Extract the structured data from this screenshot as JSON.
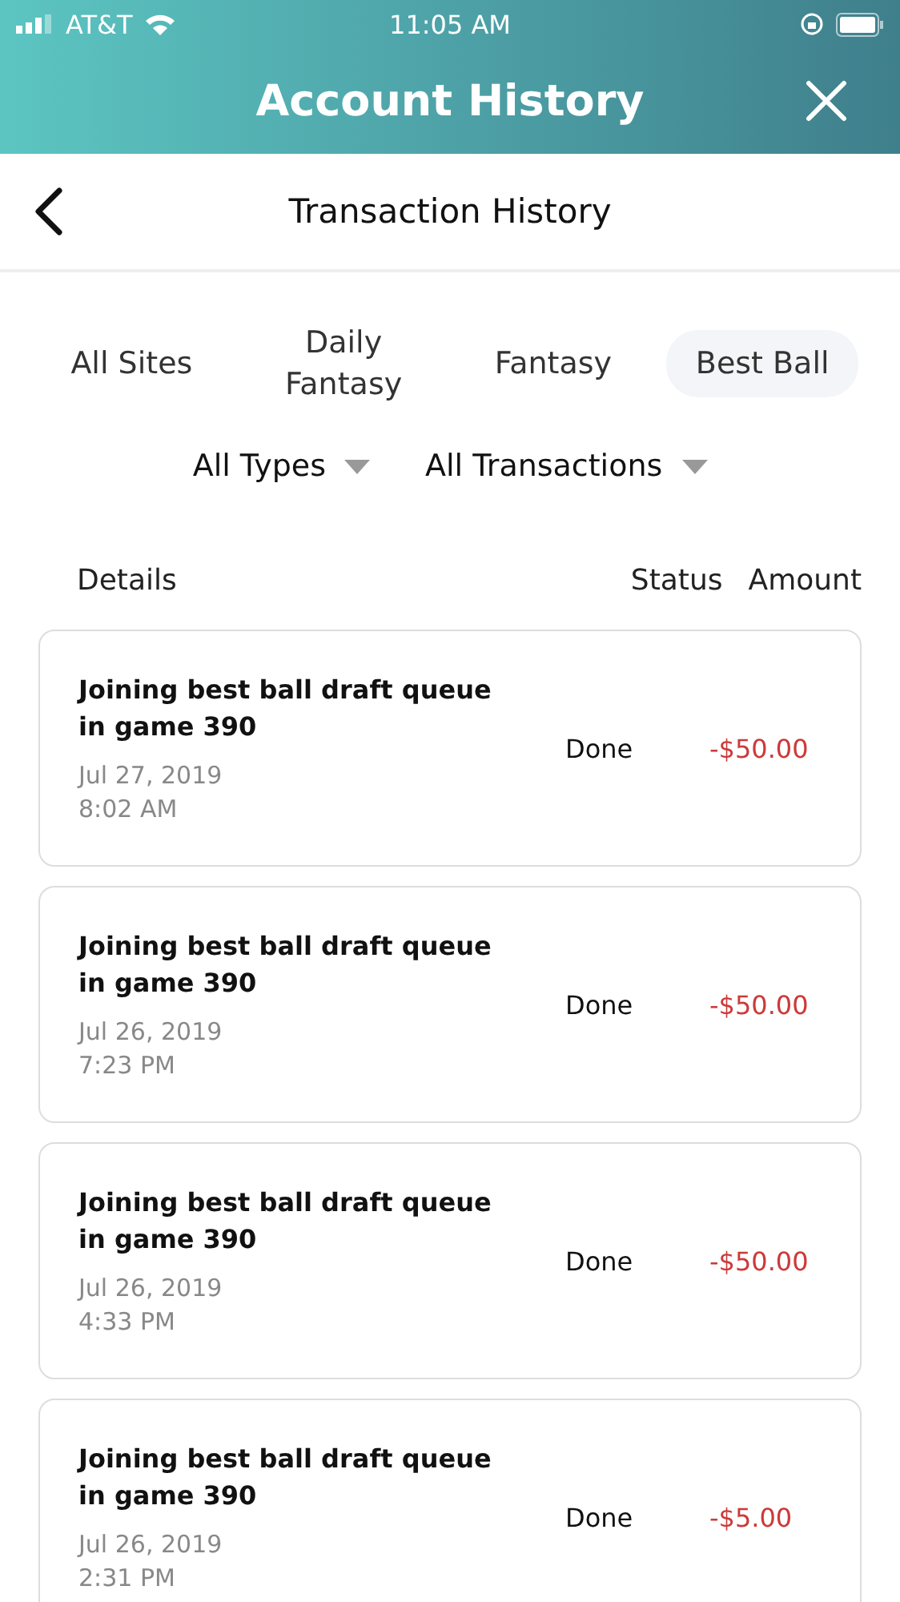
{
  "status_bar": {
    "carrier": "AT&T",
    "time": "11:05 AM"
  },
  "header": {
    "title": "Account History"
  },
  "subheader": {
    "title": "Transaction History"
  },
  "tabs": [
    {
      "label": "All Sites",
      "selected": false
    },
    {
      "label": "Daily Fantasy",
      "selected": false
    },
    {
      "label": "Fantasy",
      "selected": false
    },
    {
      "label": "Best Ball",
      "selected": true
    }
  ],
  "filters": [
    {
      "label": "All Types"
    },
    {
      "label": "All Transactions"
    }
  ],
  "columns": [
    "Details",
    "Status",
    "Amount"
  ],
  "transactions": [
    {
      "details": "Joining best ball draft queue in game 390",
      "date": "Jul 27, 2019",
      "time": "8:02 AM",
      "status": "Done",
      "amount": "-$50.00"
    },
    {
      "details": "Joining best ball draft queue in game 390",
      "date": "Jul 26, 2019",
      "time": "7:23 PM",
      "status": "Done",
      "amount": "-$50.00"
    },
    {
      "details": "Joining best ball draft queue in game 390",
      "date": "Jul 26, 2019",
      "time": "4:33 PM",
      "status": "Done",
      "amount": "-$50.00"
    },
    {
      "details": "Joining best ball draft queue in game 390",
      "date": "Jul 26, 2019",
      "time": "2:31 PM",
      "status": "Done",
      "amount": "-$5.00"
    }
  ]
}
